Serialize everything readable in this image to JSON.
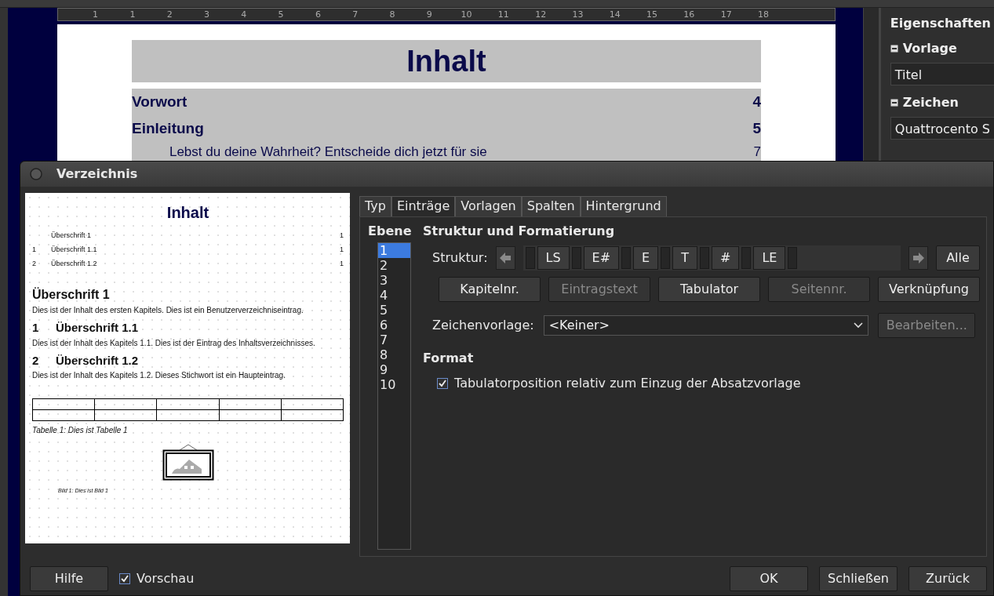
{
  "ruler": {
    "labels": [
      "1",
      "1",
      "2",
      "3",
      "4",
      "5",
      "6",
      "7",
      "8",
      "9",
      "10",
      "11",
      "12",
      "13",
      "14",
      "15",
      "16",
      "17",
      "18"
    ]
  },
  "document": {
    "title": "Inhalt",
    "toc": [
      {
        "text": "Vorwort",
        "page": "4"
      },
      {
        "text": "Einleitung",
        "page": "5",
        "children": [
          {
            "text": "Lebst du deine Wahrheit? Entscheide dich jetzt für sie",
            "page": "7"
          }
        ]
      }
    ]
  },
  "sidebar": {
    "title": "Eigenschaften",
    "sections": [
      {
        "label": "Vorlage",
        "value": "Titel"
      },
      {
        "label": "Zeichen",
        "value": "Quattrocento S"
      }
    ]
  },
  "dialog": {
    "title": "Verzeichnis",
    "preview": {
      "title": "Inhalt",
      "toc": [
        {
          "text": "Überschrift 1",
          "page": "1"
        },
        {
          "number": "1",
          "text": "Überschrift 1.1",
          "page": "1"
        },
        {
          "number": "2",
          "text": "Überschrift 1.2",
          "page": "1"
        }
      ],
      "blocks": [
        {
          "kind": "heading",
          "text": "Überschrift 1"
        },
        {
          "kind": "paragraph",
          "text": "Dies ist der Inhalt des ersten Kapitels. Dies ist ein Benutzerverzeichniseintrag."
        },
        {
          "kind": "heading",
          "number": "1",
          "text": "Überschrift 1.1"
        },
        {
          "kind": "paragraph",
          "text": "Dies ist der Inhalt des Kapitels 1.1. Dies ist der Eintrag des Inhaltsverzeichnisses."
        },
        {
          "kind": "heading",
          "number": "2",
          "text": "Überschrift 1.2"
        },
        {
          "kind": "paragraph",
          "text": "Dies ist der Inhalt des Kapitels 1.2. Dieses Stichwort ist ein Haupteintrag."
        },
        {
          "kind": "table"
        },
        {
          "kind": "caption",
          "text": "Tabelle 1: Dies ist Tabelle 1"
        },
        {
          "kind": "image"
        },
        {
          "kind": "image-caption",
          "text": "Bild 1: Dies ist Bild 1"
        }
      ]
    },
    "tabs": [
      {
        "label": "Typ",
        "selected": false
      },
      {
        "label": "Einträge",
        "selected": true
      },
      {
        "label": "Vorlagen",
        "selected": false
      },
      {
        "label": "Spalten",
        "selected": false
      },
      {
        "label": "Hintergrund",
        "selected": false
      }
    ],
    "levels_label": "Ebene",
    "levels": [
      {
        "label": "1",
        "selected": true
      },
      {
        "label": "2",
        "selected": false
      },
      {
        "label": "3",
        "selected": false
      },
      {
        "label": "4",
        "selected": false
      },
      {
        "label": "5",
        "selected": false
      },
      {
        "label": "6",
        "selected": false
      },
      {
        "label": "7",
        "selected": false
      },
      {
        "label": "8",
        "selected": false
      },
      {
        "label": "9",
        "selected": false
      },
      {
        "label": "10",
        "selected": false
      }
    ],
    "section_title": "Struktur und Formatierung",
    "structure_label": "Struktur:",
    "tokens": [
      "LS",
      "E#",
      "E",
      "T",
      "#",
      "LE"
    ],
    "all_button": "Alle",
    "insert_buttons": [
      {
        "label": "Kapitelnr.",
        "disabled": false
      },
      {
        "label": "Eintragstext",
        "disabled": true
      },
      {
        "label": "Tabulator",
        "disabled": false
      },
      {
        "label": "Seitennr.",
        "disabled": true
      },
      {
        "label": "Verknüpfung",
        "disabled": false
      }
    ],
    "char_style_label": "Zeichenvorlage:",
    "char_style_value": "<Keiner>",
    "edit_button": {
      "label": "Bearbeiten...",
      "disabled": true
    },
    "format_title": "Format",
    "tab_relative": {
      "label": "Tabulatorposition relativ zum Einzug der Absatzvorlage",
      "checked": true
    },
    "footer": {
      "help": "Hilfe",
      "preview_toggle": {
        "label": "Vorschau",
        "checked": true
      },
      "buttons": [
        "OK",
        "Schließen",
        "Zurück"
      ]
    }
  }
}
